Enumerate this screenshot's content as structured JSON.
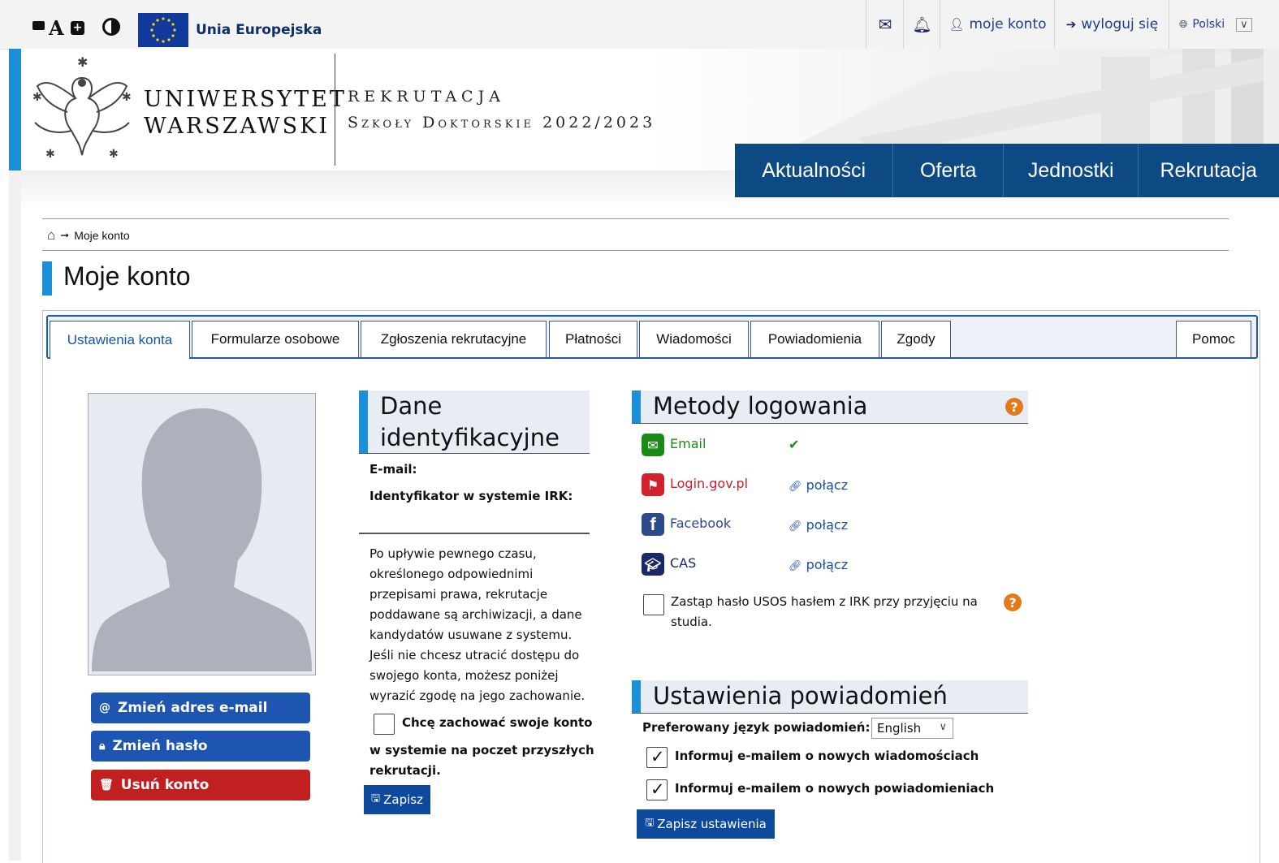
{
  "topbar": {
    "accessibility": {
      "decrease": "▬",
      "font": "A",
      "increase": "⊕",
      "contrast": "◑"
    },
    "eu_label": "Unia Europejska",
    "mail_icon": "✉",
    "bell_icon": "🔔",
    "account_label": "moje konto",
    "logout_label": "wyloguj się",
    "language_label": "Polski",
    "language_chevron": "⌵"
  },
  "header": {
    "uni_line1": "UNIWERSYTET",
    "uni_line2": "WARSZAWSKI",
    "rek_line1": "REKRUTACJA",
    "rek_line2": "Szkoły Doktorskie 2022/2023"
  },
  "nav": {
    "items": [
      {
        "label": "Aktualności"
      },
      {
        "label": "Oferta"
      },
      {
        "label": "Jednostki"
      },
      {
        "label": "Rekrutacja"
      }
    ]
  },
  "breadcrumb": {
    "arrow": "➞",
    "current": "Moje konto"
  },
  "page": {
    "title": "Moje konto"
  },
  "tabs": [
    {
      "label": "Ustawienia konta"
    },
    {
      "label": "Formularze osobowe"
    },
    {
      "label": "Zgłoszenia rekrutacyjne"
    },
    {
      "label": "Płatności"
    },
    {
      "label": "Wiadomości"
    },
    {
      "label": "Powiadomienia"
    },
    {
      "label": "Zgody"
    },
    {
      "label": "Pomoc"
    }
  ],
  "buttons": {
    "change_email": "Zmień adres e-mail",
    "change_password": "Zmień hasło",
    "delete_account": "Usuń konto"
  },
  "identity": {
    "heading_line1": "Dane",
    "heading_line2": "identyfikacyjne",
    "email_label": "E-mail:",
    "irk_label": "Identyfikator w systemie IRK:",
    "archive_text": "Po upływie pewnego czasu, określonego odpowiednimi przepisami prawa, rekrutacje poddawane są archiwizacji, a dane kandydatów usuwane z systemu. Jeśli nie chcesz utracić dostępu do swojego konta, możesz poniżej wyrazić zgodę na jego zachowanie.",
    "keep_first": "Chcę zachować swoje konto",
    "keep_rest": "w systemie na poczet przyszłych rekrutacji.",
    "save_label": "Zapisz"
  },
  "login_methods": {
    "heading": "Metody logowania",
    "methods": [
      {
        "name": "Email",
        "action": "✔",
        "color": "#1b8a1b",
        "name_color": "#1b8a1b"
      },
      {
        "name": "Login.gov.pl",
        "action": "połącz",
        "color": "#d4202e",
        "name_color": "#c8202c"
      },
      {
        "name": "Facebook",
        "action": "połącz",
        "color": "#2c4a8a",
        "name_color": "#2a4a8a"
      },
      {
        "name": "CAS",
        "action": "połącz",
        "color": "#1a2768",
        "name_color": "#1a2768"
      }
    ],
    "replace_password_text": "Zastąp hasło USOS hasłem z IRK przy przyjęciu na studia."
  },
  "notifications": {
    "heading": "Ustawienia powiadomień",
    "language_label": "Preferowany język powiadomień:",
    "language_value": "English",
    "notify_messages": "Informuj e-mailem o nowych wiadomościach",
    "notify_notifications": "Informuj e-mailem o nowych powiadomieniach",
    "save_label": "Zapisz ustawienia"
  }
}
